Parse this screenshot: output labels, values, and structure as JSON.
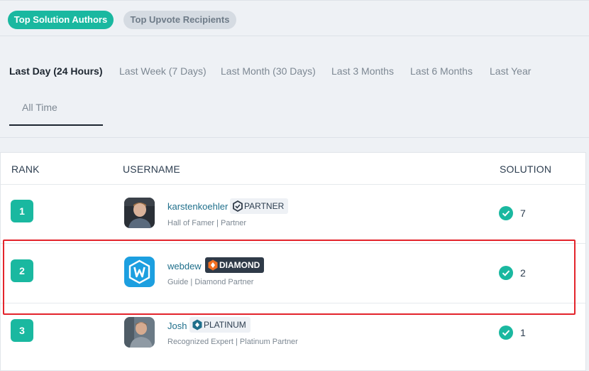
{
  "top_tabs": {
    "solution_authors": "Top Solution Authors",
    "upvote_recipients": "Top Upvote Recipients"
  },
  "periods": [
    "Last Day (24 Hours)",
    "Last Week (7 Days)",
    "Last Month (30 Days)",
    "Last 3 Months",
    "Last 6 Months",
    "Last Year",
    "All Time"
  ],
  "table": {
    "headers": {
      "rank": "RANK",
      "username": "USERNAME",
      "solution": "SOLUTION"
    },
    "rows": [
      {
        "rank": "1",
        "username": "karstenkoehler",
        "badge": "PARTNER",
        "subtitle": "Hall of Famer | Partner",
        "solutions": "7"
      },
      {
        "rank": "2",
        "username": "webdew",
        "badge": "DIAMOND",
        "subtitle": "Guide | Diamond Partner",
        "solutions": "2"
      },
      {
        "rank": "3",
        "username": "Josh",
        "badge": "PLATINUM",
        "subtitle": "Recognized Expert | Platinum Partner",
        "solutions": "1"
      }
    ]
  },
  "colors": {
    "accent": "#1ab8a0",
    "highlight": "#e3242b",
    "link": "#1f6f8b"
  }
}
